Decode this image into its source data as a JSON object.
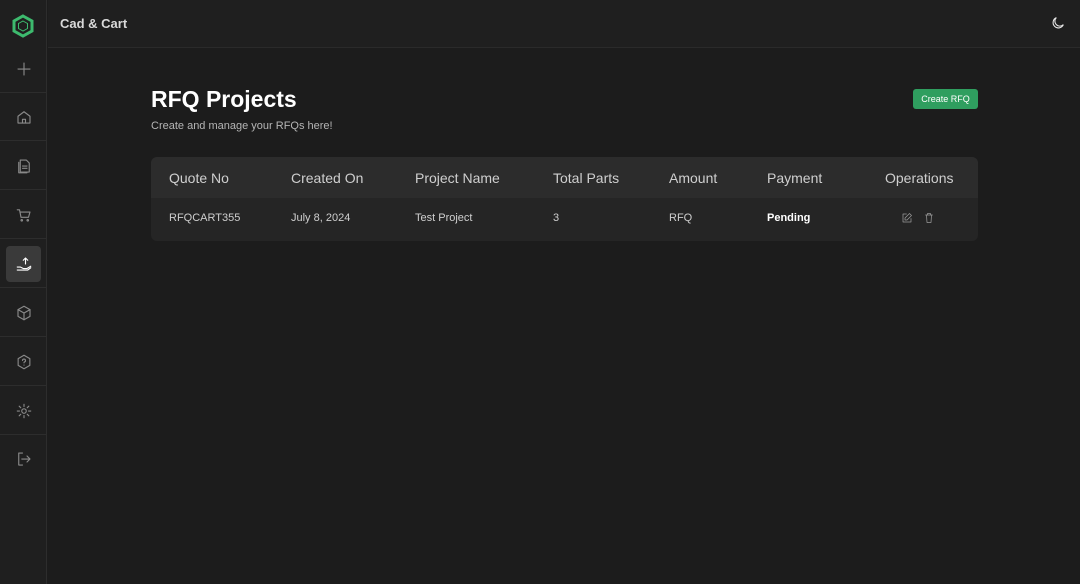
{
  "app": {
    "title": "Cad & Cart"
  },
  "sidebar": {
    "items": [
      {
        "name": "sidebar-item-new",
        "icon": "plus-icon"
      },
      {
        "name": "sidebar-item-home",
        "icon": "home-icon"
      },
      {
        "name": "sidebar-item-documents",
        "icon": "document-icon"
      },
      {
        "name": "sidebar-item-cart",
        "icon": "cart-icon"
      },
      {
        "name": "sidebar-item-rfq",
        "icon": "hand-upload-icon",
        "active": true
      },
      {
        "name": "sidebar-item-products",
        "icon": "box-icon"
      },
      {
        "name": "sidebar-item-help",
        "icon": "help-icon"
      },
      {
        "name": "sidebar-item-settings",
        "icon": "gear-icon"
      },
      {
        "name": "sidebar-item-logout",
        "icon": "logout-icon"
      }
    ]
  },
  "header": {
    "title": "RFQ Projects",
    "subtitle": "Create and manage your RFQs here!",
    "create_label": "Create RFQ"
  },
  "table": {
    "columns": [
      "Quote No",
      "Created On",
      "Project Name",
      "Total Parts",
      "Amount",
      "Payment",
      "Operations"
    ],
    "rows": [
      {
        "quote_no": "RFQCART355",
        "created_on": "July 8, 2024",
        "project_name": "Test Project",
        "total_parts": "3",
        "amount": "RFQ",
        "payment": "Pending"
      }
    ]
  },
  "colors": {
    "accent": "#2f9e5f",
    "background": "#1c1c1c",
    "logo": "#3dba6e"
  }
}
